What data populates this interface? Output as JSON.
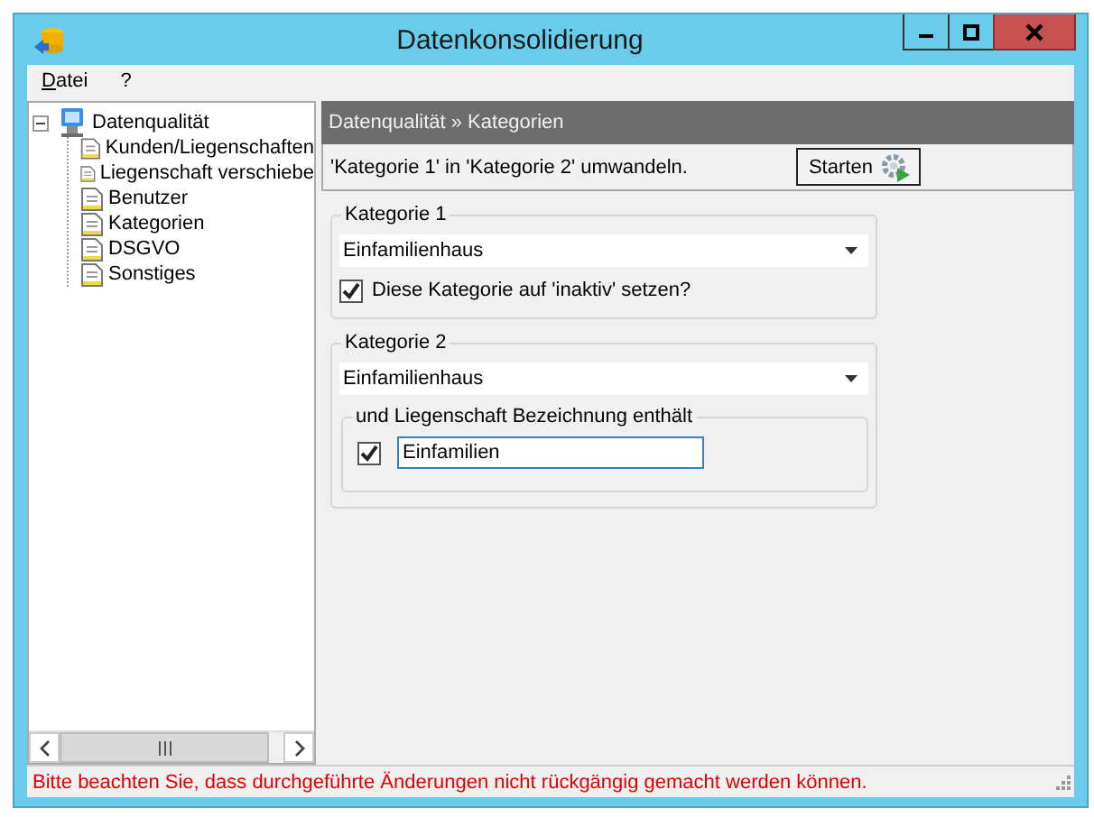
{
  "window": {
    "title": "Datenkonsolidierung"
  },
  "menu": [
    {
      "label": "Datei",
      "mnemonic": true
    },
    {
      "label": "?"
    }
  ],
  "tree": {
    "label": "Datenqualität",
    "expanded": true,
    "children": [
      {
        "label": "Kunden/Liegenschaften"
      },
      {
        "label": "Liegenschaft verschiebe"
      },
      {
        "label": "Benutzer"
      },
      {
        "label": "Kategorien"
      },
      {
        "label": "DSGVO"
      },
      {
        "label": "Sonstiges"
      }
    ]
  },
  "header": {
    "breadcrumb": "Datenqualität » Kategorien"
  },
  "action": {
    "description": "'Kategorie 1' in 'Kategorie 2' umwandeln.",
    "button": "Starten"
  },
  "group1": {
    "legend": "Kategorie 1",
    "value": "Einfamilienhaus",
    "checkbox": {
      "label": "Diese Kategorie auf 'inaktiv' setzen?",
      "checked": true
    }
  },
  "group2": {
    "legend": "Kategorie 2",
    "value": "Einfamilienhaus",
    "subgroup": {
      "legend": "und Liegenschaft Bezeichnung enthält",
      "checked": true,
      "text": "Einfamilien"
    }
  },
  "status_bar": {
    "message": "Bitte beachten Sie, dass durchgeführte Änderungen nicht rückgängig gemacht werden können."
  }
}
